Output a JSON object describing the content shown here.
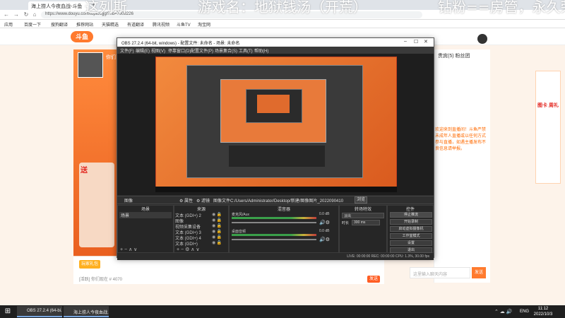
{
  "browser": {
    "tab_title": "海上捞人今夜血战-斗鱼",
    "newtab_icon": "+",
    "url": "https://www.douyu.com/topic/zjjgl?rid=7608226",
    "bookmarks": [
      "应用",
      "百度一下",
      "搜狗翻译",
      "推荐网站",
      "天猫精选",
      "有道翻译",
      "腾讯视频",
      "斗鱼TV",
      "淘宝网"
    ]
  },
  "overlay": {
    "text1": "这列斯",
    "text2": "游戏名：地狱钱汤（开荒）",
    "text3": "钻粉==房管，永久荣"
  },
  "douyu": {
    "logo": "斗鱼",
    "streamer_name": "你们了 1 公告",
    "gift_title": "送",
    "bottom_tag": "玩家礼包",
    "bottom_info": "[活跃] 你们现在 # 4070",
    "send": "发送",
    "chat_header": "贵宾(5) 粉丝团",
    "chat_text": "欢迎来到直播间！斗鱼严禁未成年人直播或以任何方式参与直播，如遇主播发布不良信息请举报。",
    "chat_input_placeholder": "这里输入聊天内容",
    "chat_send": "发送",
    "promo_title": "图卡 周礼"
  },
  "obs": {
    "title": "OBS 27.2.4 (64-bit, windows) - 配置文件: 未命名 - 场景: 未命名",
    "menu": [
      "文件(F)",
      "编辑(E)",
      "视图(V)",
      "停靠窗口(D)",
      "配置文件(P)",
      "场景集合(S)",
      "工具(T)",
      "帮助(H)"
    ],
    "toolbar": {
      "scene_icon": "图像",
      "properties": "⚙ 属性",
      "filters": "⚙ 滤镜",
      "image_file": "图像文件",
      "file_path": "C:/Users/Administrator/Desktop/新建/图像图片_20220904103257.jpg",
      "browse": "浏览"
    },
    "docks": {
      "scenes": "场景",
      "sources": "来源",
      "mixer": "混音器",
      "transitions": "转场特效",
      "controls": "控件"
    },
    "scenes": [
      "场景"
    ],
    "sources": [
      "文本 (GDI+) 2",
      "图像",
      "视频采集设备",
      "文本 (GDI+) 3",
      "文本 (GDI+) 4",
      "文本 (GDI+)"
    ],
    "mixer": [
      {
        "name": "麦克风/Aux",
        "value": "0.0 dB"
      },
      {
        "name": "桌面音频",
        "value": "0.0 dB"
      }
    ],
    "transitions": {
      "select": "淡出",
      "duration_label": "时长",
      "duration": "300 ms"
    },
    "controls": [
      "停止推流",
      "开始录制",
      "启动虚拟摄像机",
      "工作室模式",
      "设置",
      "退出"
    ],
    "status": "LIVE: 00:00:00   REC: 00:00:00   CPU: 1.3%, 30.00 fps",
    "window_min": "–",
    "window_max": "☐",
    "window_close": "✕"
  },
  "taskbar": {
    "start_icon": "⊞",
    "tasks": [
      "OBS 27.2.4 (64-bi...",
      "海上捞人今夜血战..."
    ],
    "lang": "ENG",
    "time": "11:12",
    "date": "2022/10/3",
    "tray": "⌃ ☁ 🔊"
  },
  "colors": {
    "accent": "#ff7a2e",
    "obs_bg": "#2b2b2b",
    "live": "#ff5d23"
  }
}
